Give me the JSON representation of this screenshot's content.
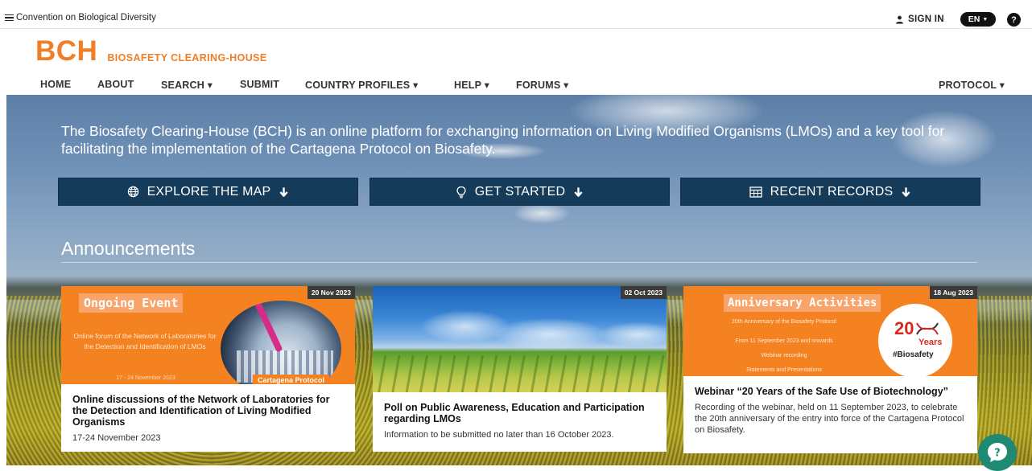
{
  "topbar": {
    "org_link": "Convention on Biological Diversity",
    "sign_in": "SIGN IN",
    "language": "EN",
    "help": "?"
  },
  "brand": {
    "logo": "BCH",
    "subtitle": "BIOSAFETY CLEARING-HOUSE",
    "color": "#f07e26"
  },
  "nav": {
    "items": [
      {
        "label": "HOME"
      },
      {
        "label": "ABOUT"
      },
      {
        "label": "SEARCH ▾"
      },
      {
        "label": "SUBMIT"
      },
      {
        "label": "COUNTRY PROFILES ▾"
      },
      {
        "label": "HELP ▾"
      },
      {
        "label": "FORUMS ▾"
      }
    ],
    "protocol": "PROTOCOL ▾"
  },
  "hero": {
    "intro": "The Biosafety Clearing-House (BCH) is an online platform for exchanging information on Living Modified Organisms (LMOs) and a key tool for facilitating the implementation of the Cartagena Protocol on Biosafety.",
    "buttons": [
      {
        "label": "EXPLORE THE MAP",
        "icon": "globe-icon"
      },
      {
        "label": "GET STARTED",
        "icon": "lightbulb-icon"
      },
      {
        "label": "RECENT RECORDS",
        "icon": "table-icon"
      }
    ],
    "button_color": "#143c5a"
  },
  "announcements": {
    "heading": "Announcements",
    "cards": [
      {
        "date": "20 Nov 2023",
        "image_badge": "Ongoing Event",
        "image_text": "Online forum of the Network of Laboratories for the Detection and Identification of LMOs",
        "image_footer": "17 - 24 November 2023",
        "image_label": "Cartagena Protocol",
        "title": "Online discussions of the Network of Laboratories for the Detection and Identification of Living Modified Organisms",
        "text": "17-24 November 2023"
      },
      {
        "date": "02 Oct 2023",
        "title": "Poll on Public Awareness, Education and Participation regarding LMOs",
        "text": "Information to be submitted no later than 16 October 2023."
      },
      {
        "date": "18 Aug 2023",
        "image_badge": "Anniversary Activities",
        "image_lines": [
          "20th Anniversary of the Biosafety Protocol",
          "From 11 September 2023 and onwards",
          "Webinar recording",
          "Statements and Presentations"
        ],
        "logo_number": "20",
        "logo_word": "Years",
        "logo_tag": "#Biosafety",
        "title": "Webinar “20 Years of the Safe Use of Biotechnology”",
        "text": "Recording of the webinar, held on 11 September 2023, to celebrate the 20th anniversary of the entry into force of the Cartagena Protocol on Biosafety."
      }
    ]
  }
}
